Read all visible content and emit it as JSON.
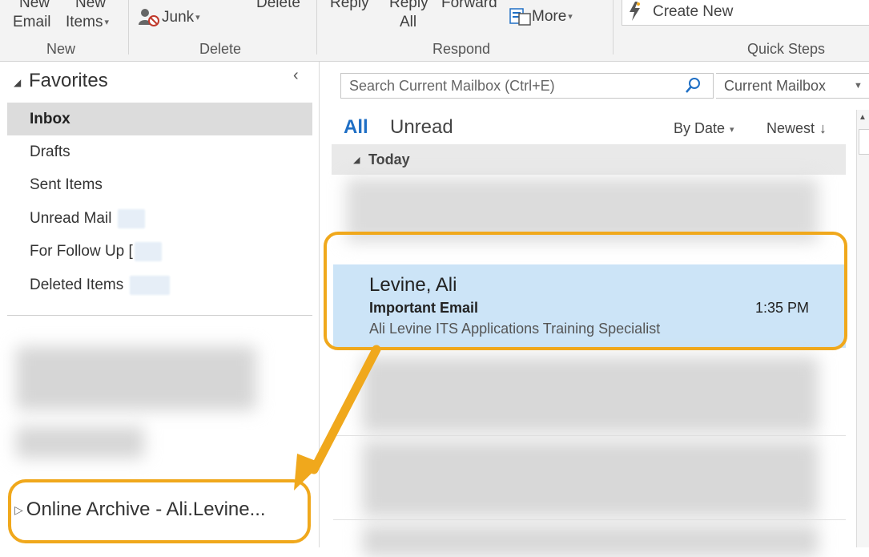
{
  "ribbon": {
    "new_email_line1": "New",
    "new_email_line2": "Email",
    "new_items_line1": "New",
    "new_items_line2": "Items",
    "junk_label": "Junk",
    "delete_label": "Delete",
    "reply_label": "Reply",
    "reply_all_line1": "Reply",
    "reply_all_line2": "All",
    "forward_label": "Forward",
    "more_label": "More",
    "quick_step": "Create New",
    "groups": {
      "new": "New",
      "delete": "Delete",
      "respond": "Respond",
      "quick_steps": "Quick Steps"
    }
  },
  "nav": {
    "favorites": "Favorites",
    "collapse_glyph": "‹",
    "items": [
      {
        "label": "Inbox"
      },
      {
        "label": "Drafts"
      },
      {
        "label": "Sent Items"
      },
      {
        "label": "Unread Mail"
      },
      {
        "label": "For Follow Up ["
      },
      {
        "label": "Deleted Items"
      }
    ],
    "archive": "Online Archive - Ali.Levine..."
  },
  "search": {
    "placeholder": "Search Current Mailbox (Ctrl+E)",
    "scope": "Current Mailbox"
  },
  "list": {
    "filter_all": "All",
    "filter_unread": "Unread",
    "sort_by": "By Date",
    "order": "Newest",
    "group_today": "Today"
  },
  "mail": {
    "sender": "Levine, Ali",
    "subject": "Important Email",
    "time": "1:35 PM",
    "preview": "Ali Levine  ITS Applications Training Specialist"
  },
  "colors": {
    "accent": "#1f6fc5",
    "selected_mail": "#cce4f7",
    "highlight": "#f0a81c"
  }
}
